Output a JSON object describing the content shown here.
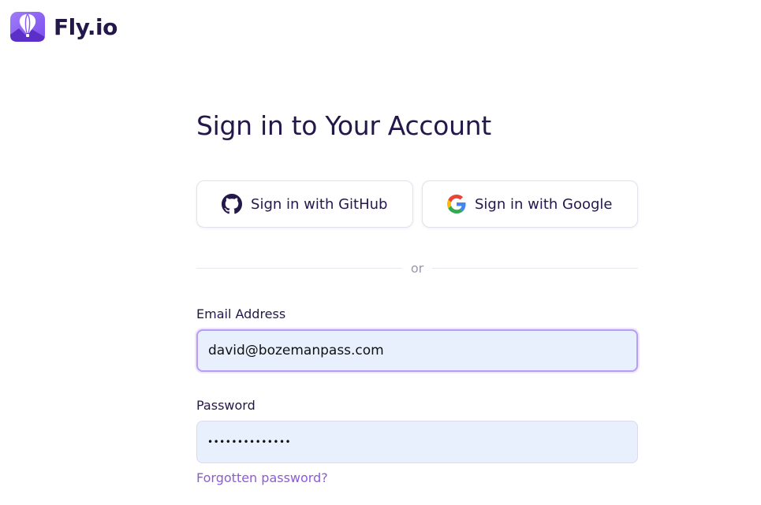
{
  "brand": {
    "name": "Fly.io",
    "primary_color": "#8a5cf5",
    "text_color": "#24174a",
    "link_color": "#8e5bd8"
  },
  "signin": {
    "title": "Sign in to Your Account",
    "github_label": "Sign in with GitHub",
    "google_label": "Sign in with Google",
    "divider_text": "or",
    "email_label": "Email Address",
    "email_value": "david@bozemanpass.com",
    "password_label": "Password",
    "password_value": "••••••••••••••",
    "forgot_label": "Forgotten password?"
  },
  "icons": {
    "logo": "flyio-balloon-logo",
    "github": "github-icon",
    "google": "google-icon"
  }
}
